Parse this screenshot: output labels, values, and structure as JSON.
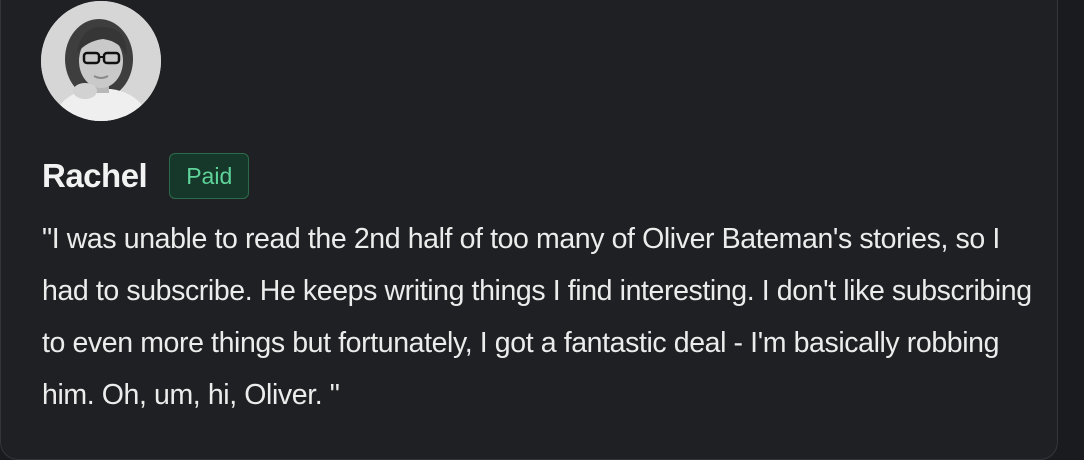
{
  "testimonial": {
    "avatar_icon": "user-portrait-photo",
    "name": "Rachel",
    "badge": "Paid",
    "quote": "\"I was unable to read the 2nd half of too many of Oliver Bateman's stories, so I had to subscribe. He keeps writing things I find interesting. I don't like subscribing to even more things but fortunately, I got a fantastic deal - I'm basically robbing him. Oh, um, hi, Oliver. \""
  },
  "colors": {
    "background": "#1f2023",
    "badge_bg": "#16382a",
    "badge_text": "#5fd39a",
    "text": "#ececec"
  }
}
